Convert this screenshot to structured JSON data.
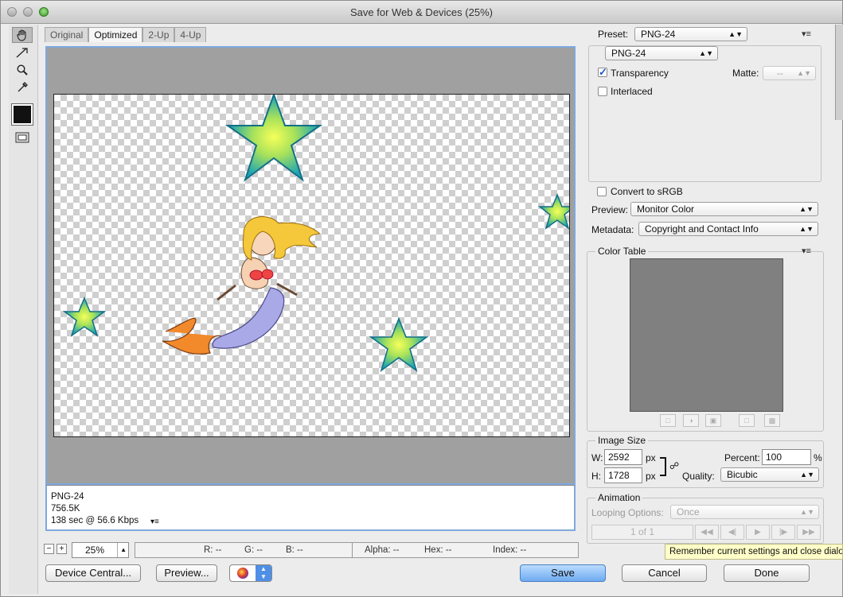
{
  "window": {
    "title": "Save for Web & Devices (25%)"
  },
  "tabs": [
    "Original",
    "Optimized",
    "2-Up",
    "4-Up"
  ],
  "image_info": {
    "format": "PNG-24",
    "size": "756.5K",
    "time": "138 sec @ 56.6 Kbps"
  },
  "status_bar": {
    "zoom": "25%",
    "r": "R: --",
    "g": "G: --",
    "b": "B: --",
    "alpha": "Alpha: --",
    "hex": "Hex: --",
    "index": "Index: --"
  },
  "buttons": {
    "device_central": "Device Central...",
    "preview": "Preview...",
    "save": "Save",
    "cancel": "Cancel",
    "done": "Done"
  },
  "settings": {
    "preset_label": "Preset:",
    "preset_value": "PNG-24",
    "format_value": "PNG-24",
    "transparency_label": "Transparency",
    "transparency_checked": true,
    "matte_label": "Matte:",
    "matte_value": "--",
    "interlaced_label": "Interlaced",
    "interlaced_checked": false,
    "convert_srgb_label": "Convert to sRGB",
    "preview_label": "Preview:",
    "preview_value": "Monitor Color",
    "metadata_label": "Metadata:",
    "metadata_value": "Copyright and Contact Info"
  },
  "color_table": {
    "title": "Color Table"
  },
  "image_size": {
    "title": "Image Size",
    "w_label": "W:",
    "w_value": "2592",
    "h_label": "H:",
    "h_value": "1728",
    "unit": "px",
    "percent_label": "Percent:",
    "percent_value": "100",
    "percent_unit": "%",
    "quality_label": "Quality:",
    "quality_value": "Bicubic"
  },
  "animation": {
    "title": "Animation",
    "looping_label": "Looping Options:",
    "looping_value": "Once",
    "frame_counter": "1 of 1"
  },
  "tooltip": "Remember current settings and close dialog",
  "icons": [
    "hand-icon",
    "slice-select-icon",
    "zoom-icon",
    "eyedropper-icon",
    "color-swatch",
    "toggle-slices-icon",
    "panel-menu-icon",
    "link-icon",
    "browser-icon"
  ],
  "colors": {
    "accent": "#6eaaf0",
    "canvas_border": "#7fa8de",
    "color_table_fill": "#808080"
  }
}
